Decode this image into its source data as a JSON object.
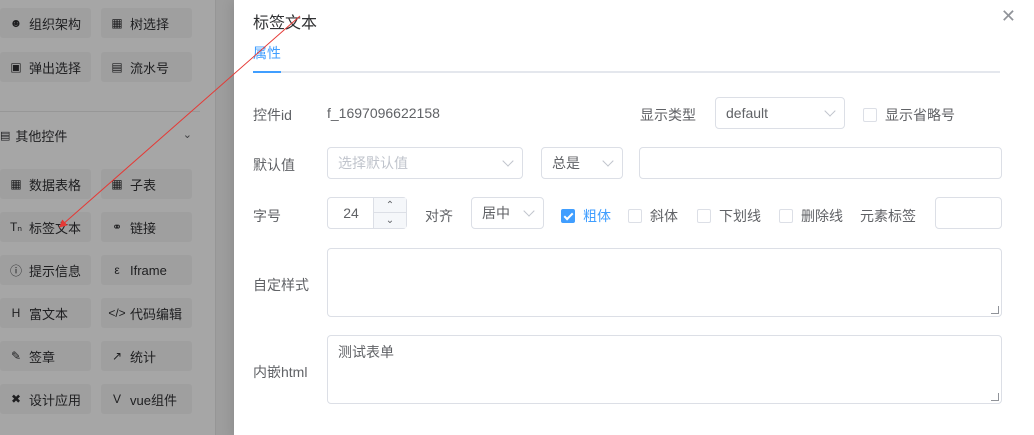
{
  "left_panel": {
    "row1": [
      {
        "icon": "org-icon",
        "label": "组织架构"
      },
      {
        "icon": "tree-icon",
        "label": "树选择"
      }
    ],
    "row2": [
      {
        "icon": "popup-icon",
        "label": "弹出选择"
      },
      {
        "icon": "serial-icon",
        "label": "流水号"
      }
    ],
    "group_title": "其他控件",
    "grid": [
      [
        {
          "icon": "table-icon",
          "label": "数据表格"
        },
        {
          "icon": "subtable-icon",
          "label": "子表"
        }
      ],
      [
        {
          "icon": "text-icon",
          "label": "标签文本"
        },
        {
          "icon": "link-icon",
          "label": "链接"
        }
      ],
      [
        {
          "icon": "info-icon",
          "label": "提示信息"
        },
        {
          "icon": "iframe-icon",
          "label": "Iframe"
        }
      ],
      [
        {
          "icon": "rich-text-icon",
          "label": "富文本"
        },
        {
          "icon": "code-icon",
          "label": "代码编辑"
        }
      ],
      [
        {
          "icon": "signature-icon",
          "label": "签章"
        },
        {
          "icon": "stats-icon",
          "label": "统计"
        }
      ],
      [
        {
          "icon": "design-icon",
          "label": "设计应用"
        },
        {
          "icon": "vue-icon",
          "label": "vue组件"
        }
      ]
    ]
  },
  "dialog": {
    "title": "标签文本",
    "tab": "属性",
    "control_id_label": "控件id",
    "control_id_value": "f_1697096622158",
    "display_type_label": "显示类型",
    "display_type_value": "default",
    "show_ellipsis_label": "显示省略号",
    "default_value_label": "默认值",
    "default_value_placeholder": "选择默认值",
    "always_value": "总是",
    "font_size_label": "字号",
    "font_size_value": "24",
    "align_label": "对齐",
    "align_value": "居中",
    "bold_label": "粗体",
    "italic_label": "斜体",
    "underline_label": "下划线",
    "strike_label": "删除线",
    "element_tag_label": "元素标签",
    "custom_style_label": "自定样式",
    "inner_html_label": "内嵌html",
    "inner_html_value": "测试表单"
  }
}
